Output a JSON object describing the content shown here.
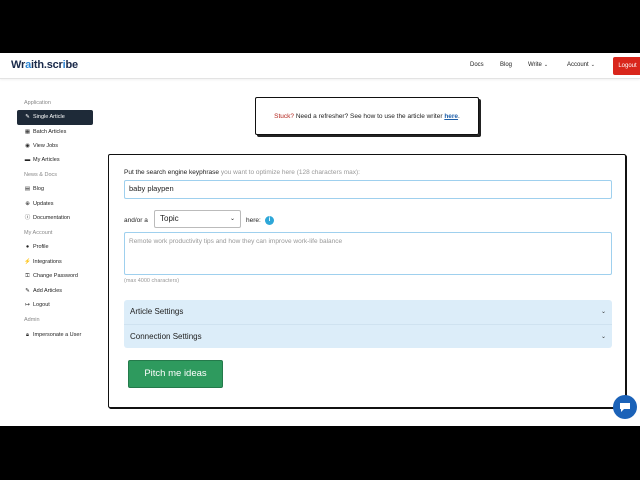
{
  "navbar": {
    "logo_pre": "Wr",
    "logo_accent": "a",
    "logo_mid": "ith.scr",
    "logo_accent2": "i",
    "logo_post": "be",
    "docs": "Docs",
    "blog": "Blog",
    "write": "Write",
    "account": "Account",
    "logout": "Logout"
  },
  "sidebar": {
    "application_heading": "Application",
    "single_article": "Single Article",
    "batch_articles": "Batch Articles",
    "view_jobs": "View Jobs",
    "my_articles": "My Articles",
    "news_heading": "News & Docs",
    "blog": "Blog",
    "updates": "Updates",
    "documentation": "Documentation",
    "account_heading": "My Account",
    "profile": "Profile",
    "integrations": "Integrations",
    "change_password": "Change Password",
    "add_articles": "Add Articles",
    "logout": "Logout",
    "admin_heading": "Admin",
    "impersonate": "Impersonate a User"
  },
  "notice": {
    "stuck": "Stuck?",
    "text": " Need a refresher? See how to use the article writer ",
    "link": "here",
    "end": "."
  },
  "form": {
    "keyphrase_label": "Put the search engine keyphrase",
    "keyphrase_hint": " you want to optimize here (128 characters max):",
    "keyphrase_value": "baby playpen",
    "andor": "and/or a",
    "topic_selected": "Topic",
    "here": "here:",
    "info": "i",
    "topic_placeholder": "Remote work productivity tips and how they can improve work-life balance",
    "max_chars": "(max 4000 characters)",
    "article_settings": "Article Settings",
    "connection_settings": "Connection Settings",
    "pitch_button": "Pitch me ideas"
  },
  "colors": {
    "brand_accent": "#2e86d4",
    "logout_red": "#d9261c",
    "pitch_green": "#2e9a5e",
    "accordion_bg": "#dcedf9",
    "chat_blue": "#1b62b8"
  }
}
